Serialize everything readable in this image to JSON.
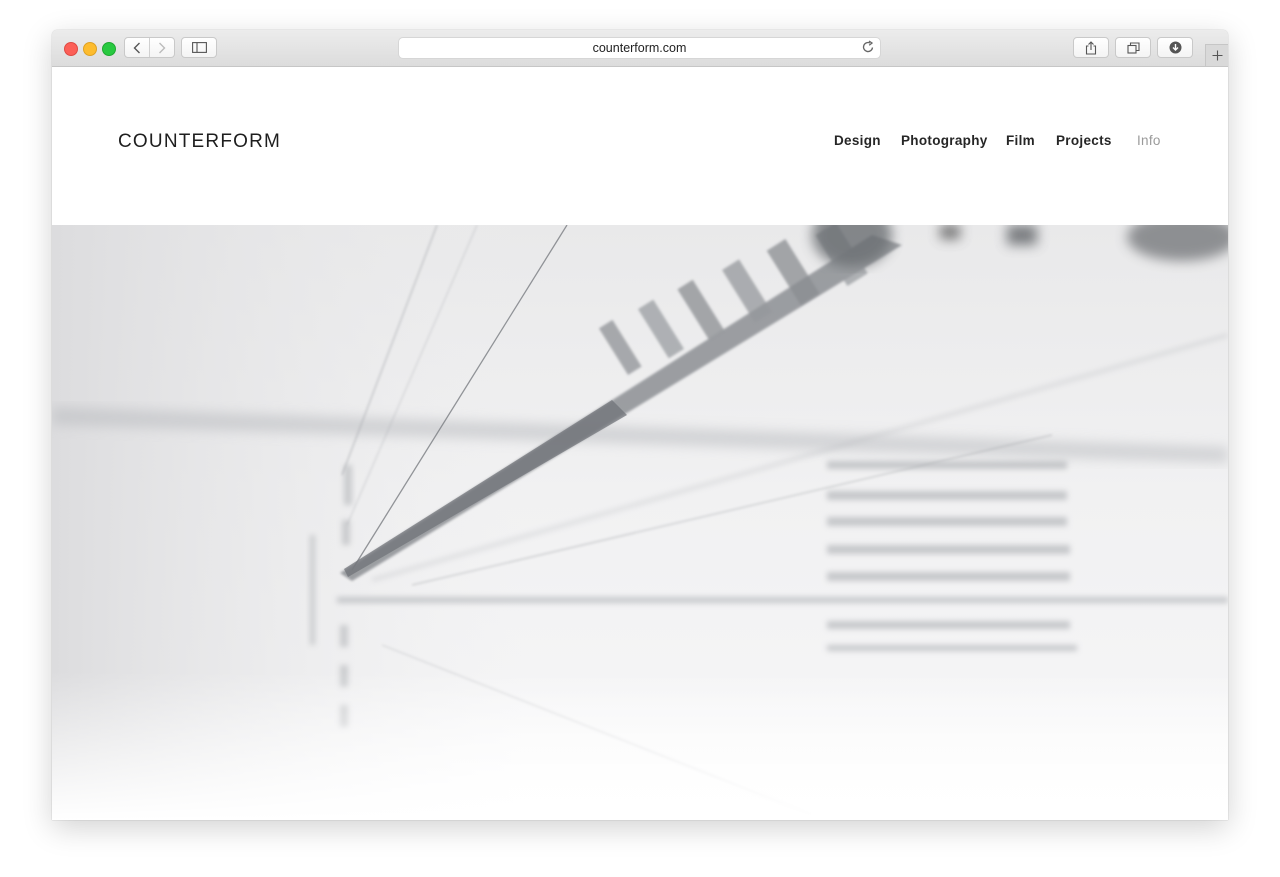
{
  "browser": {
    "url": "counterform.com"
  },
  "site": {
    "logo": "COUNTERFORM",
    "nav": [
      {
        "label": "Design"
      },
      {
        "label": "Photography"
      },
      {
        "label": "Film"
      },
      {
        "label": "Projects"
      },
      {
        "label": "Info"
      }
    ],
    "active_nav": "Info"
  },
  "icons": {
    "back": "chevron-left-icon",
    "forward": "chevron-right-icon",
    "sidebar": "sidebar-icon",
    "reload": "reload-icon",
    "share": "share-icon",
    "tabs": "tabs-overview-icon",
    "download": "download-icon",
    "new_tab": "plus-icon"
  },
  "colors": {
    "traffic_red": "#fc5f57",
    "traffic_yellow": "#fdbc2e",
    "traffic_green": "#28c940",
    "nav_text": "#262626",
    "nav_active": "#9a9a9a"
  }
}
